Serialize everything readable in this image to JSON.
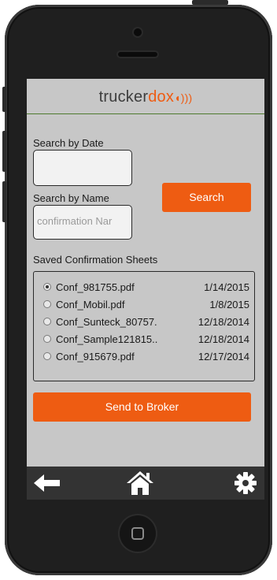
{
  "app": {
    "logo_dark": "trucker",
    "logo_accent": "dox",
    "accent_color": "#ee5c12"
  },
  "search": {
    "date_label": "Search by Date",
    "date_value": "",
    "name_label": "Search by Name",
    "name_placeholder": "confirmation Nar",
    "button_label": "Search"
  },
  "saved": {
    "label": "Saved Confirmation Sheets",
    "items": [
      {
        "name": "Conf_981755.pdf",
        "date": "1/14/2015",
        "selected": true
      },
      {
        "name": "Conf_Mobil.pdf",
        "date": "1/8/2015",
        "selected": false
      },
      {
        "name": "Conf_Sunteck_80757.",
        "date": "12/18/2014",
        "selected": false
      },
      {
        "name": "Conf_Sample121815..",
        "date": "12/18/2014",
        "selected": false
      },
      {
        "name": "Conf_915679.pdf",
        "date": "12/17/2014",
        "selected": false
      }
    ]
  },
  "actions": {
    "send_label": "Send to Broker"
  },
  "nav": {
    "back_icon": "back-arrow-icon",
    "home_icon": "home-icon",
    "settings_icon": "gear-icon"
  }
}
